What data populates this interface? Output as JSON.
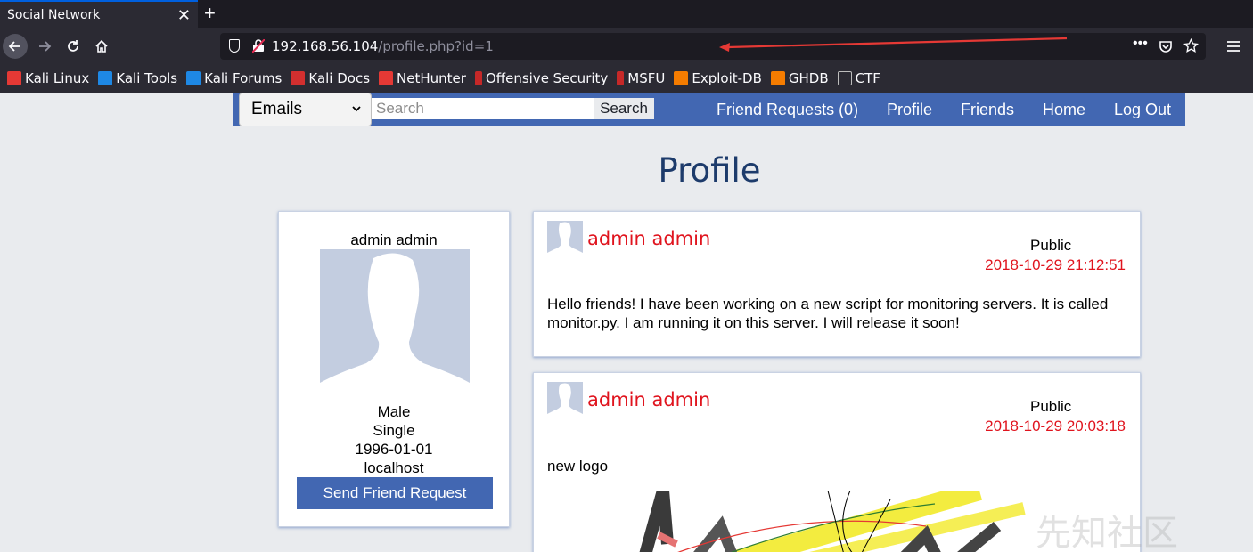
{
  "browser": {
    "tab_title": "Social Network",
    "tab_close": "✕",
    "new_tab": "+",
    "url_host": "192.168.56.104",
    "url_path": "/profile.php?id=1",
    "page_actions": "•••",
    "bookmarks": [
      {
        "label": "Kali Linux",
        "icon": "kali-dragon-icon",
        "color": "#e53935"
      },
      {
        "label": "Kali Tools",
        "icon": "kali-tools-icon",
        "color": "#1e88e5"
      },
      {
        "label": "Kali Forums",
        "icon": "kali-forums-icon",
        "color": "#1e88e5"
      },
      {
        "label": "Kali Docs",
        "icon": "kali-docs-icon",
        "color": "#d32f2f"
      },
      {
        "label": "NetHunter",
        "icon": "nethunter-icon",
        "color": "#e53935"
      },
      {
        "label": "Offensive Security",
        "icon": "offsec-icon",
        "color": "#c62828"
      },
      {
        "label": "MSFU",
        "icon": "msfu-icon",
        "color": "#c62828"
      },
      {
        "label": "Exploit-DB",
        "icon": "exploit-db-icon",
        "color": "#f57c00"
      },
      {
        "label": "GHDB",
        "icon": "ghdb-icon",
        "color": "#f57c00"
      },
      {
        "label": "CTF",
        "icon": "folder-icon",
        "color": "#bdbdbd"
      }
    ]
  },
  "site_nav": {
    "select_value": "Emails",
    "search_placeholder": "Search",
    "search_button": "Search",
    "links": {
      "friend_requests": "Friend Requests (0)",
      "profile": "Profile",
      "friends": "Friends",
      "home": "Home",
      "logout": "Log Out"
    },
    "bg_color": "#4267b2"
  },
  "page": {
    "title": "Profile"
  },
  "profile": {
    "name": "admin admin",
    "gender": "Male",
    "status": "Single",
    "birthday": "1996-01-01",
    "location": "localhost",
    "friend_button": "Send Friend Request"
  },
  "posts": [
    {
      "author": "admin admin",
      "visibility": "Public",
      "date": "2018-10-29 21:12:51",
      "body": "Hello friends! I have been working on a new script for monitoring servers. It is called monitor.py. I am running it on this server. I will release it soon!"
    },
    {
      "author": "admin admin",
      "visibility": "Public",
      "date": "2018-10-29 20:03:18",
      "body": "new logo"
    }
  ],
  "colors": {
    "accent": "#4267b2",
    "author_red": "#e0141e",
    "title_blue": "#1d3b6b"
  },
  "watermark": "先知社区"
}
